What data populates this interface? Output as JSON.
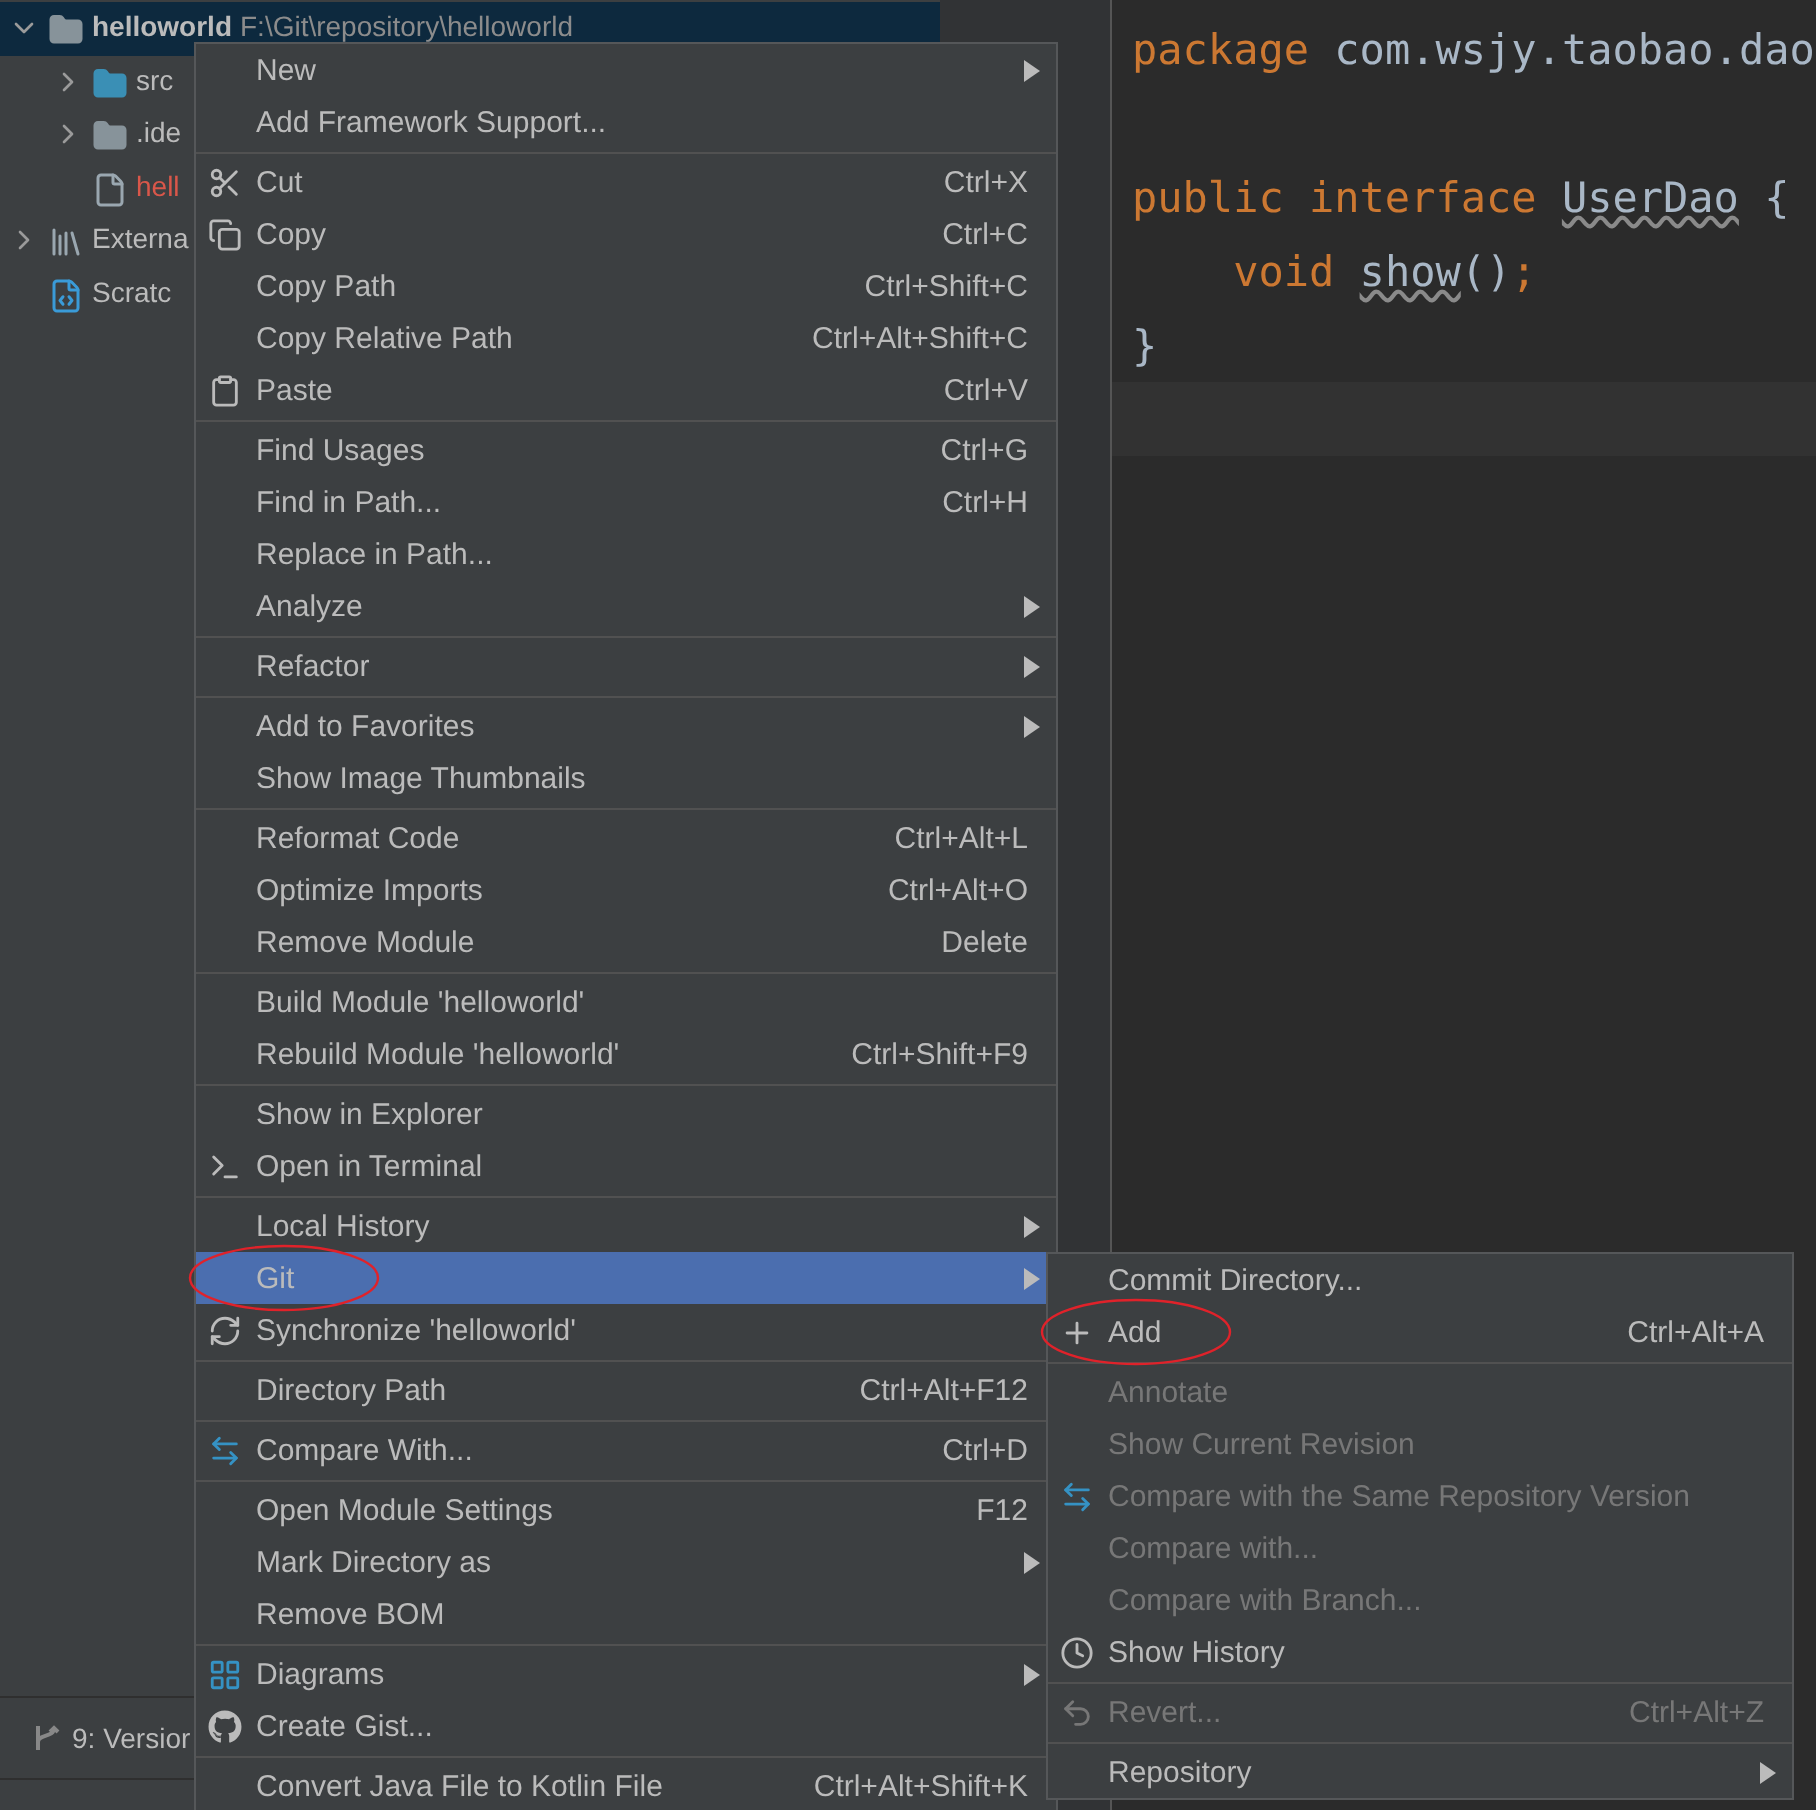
{
  "project": {
    "rows": [
      {
        "label": "helloworld",
        "detail": "F:\\Git\\repository\\helloworld",
        "kind": "module",
        "expanded": true,
        "selected": true,
        "children": [
          {
            "label": "src",
            "kind": "source-folder",
            "expanded": false,
            "selected": false
          },
          {
            "label": ".ide",
            "kind": "folder",
            "expanded": false,
            "selected": false
          },
          {
            "label": "hell",
            "kind": "file",
            "selected": false,
            "color": "#d9574a"
          }
        ]
      },
      {
        "label": "Externa",
        "kind": "library",
        "expanded": false,
        "selected": false
      },
      {
        "label": "Scratc",
        "kind": "scratch",
        "selected": false
      }
    ]
  },
  "editor": {
    "lines": [
      [
        {
          "tokens": [
            {
              "t": "package ",
              "kind": "keyword"
            },
            {
              "t": "com.wsjy.taobao.dao",
              "kind": "plain"
            }
          ]
        }
      ],
      [
        {
          "tokens": [
            {
              "t": "public interface ",
              "kind": "keyword"
            },
            {
              "t": "UserDao",
              "kind": "warn"
            },
            {
              "t": " {",
              "kind": "plain"
            }
          ]
        },
        {
          "tokens": [
            {
              "t": "    void ",
              "kind": "keyword"
            },
            {
              "t": "show",
              "kind": "warn"
            },
            {
              "t": "()",
              "kind": "plain"
            },
            {
              "t": ";",
              "kind": "keyword"
            }
          ]
        },
        {
          "tokens": [
            {
              "t": "}",
              "kind": "plain"
            }
          ]
        }
      ]
    ]
  },
  "tool_window": {
    "label": "9: Versior"
  },
  "menu": {
    "groups": [
      [
        {
          "label": "New",
          "submenu": true
        },
        {
          "label": "Add Framework Support..."
        }
      ],
      [
        {
          "label": "Cut",
          "shortcut": "Ctrl+X",
          "kind": "scissors"
        },
        {
          "label": "Copy",
          "shortcut": "Ctrl+C",
          "kind": "copy"
        },
        {
          "label": "Copy Path",
          "shortcut": "Ctrl+Shift+C"
        },
        {
          "label": "Copy Relative Path",
          "shortcut": "Ctrl+Alt+Shift+C"
        },
        {
          "label": "Paste",
          "shortcut": "Ctrl+V",
          "kind": "paste"
        }
      ],
      [
        {
          "label": "Find Usages",
          "shortcut": "Ctrl+G"
        },
        {
          "label": "Find in Path...",
          "shortcut": "Ctrl+H"
        },
        {
          "label": "Replace in Path..."
        },
        {
          "label": "Analyze",
          "submenu": true
        }
      ],
      [
        {
          "label": "Refactor",
          "submenu": true
        }
      ],
      [
        {
          "label": "Add to Favorites",
          "submenu": true
        },
        {
          "label": "Show Image Thumbnails"
        }
      ],
      [
        {
          "label": "Reformat Code",
          "shortcut": "Ctrl+Alt+L"
        },
        {
          "label": "Optimize Imports",
          "shortcut": "Ctrl+Alt+O"
        },
        {
          "label": "Remove Module",
          "shortcut": "Delete"
        }
      ],
      [
        {
          "label": "Build Module 'helloworld'"
        },
        {
          "label": "Rebuild Module 'helloworld'",
          "shortcut": "Ctrl+Shift+F9"
        }
      ],
      [
        {
          "label": "Show in Explorer"
        },
        {
          "label": "Open in Terminal",
          "kind": "terminal"
        }
      ],
      [
        {
          "label": "Local History",
          "submenu": true
        },
        {
          "label": "Git",
          "submenu": true,
          "selected": true,
          "annotated": true
        },
        {
          "label": "Synchronize 'helloworld'",
          "kind": "sync"
        }
      ],
      [
        {
          "label": "Directory Path",
          "shortcut": "Ctrl+Alt+F12"
        }
      ],
      [
        {
          "label": "Compare With...",
          "shortcut": "Ctrl+D",
          "kind": "compare"
        }
      ],
      [
        {
          "label": "Open Module Settings",
          "shortcut": "F12"
        },
        {
          "label": "Mark Directory as",
          "submenu": true
        },
        {
          "label": "Remove BOM"
        }
      ],
      [
        {
          "label": "Diagrams",
          "submenu": true,
          "kind": "diagram"
        },
        {
          "label": "Create Gist...",
          "kind": "github"
        }
      ],
      [
        {
          "label": "Convert Java File to Kotlin File",
          "shortcut": "Ctrl+Alt+Shift+K"
        }
      ]
    ]
  },
  "git_menu": {
    "groups": [
      [
        {
          "label": "Commit Directory..."
        },
        {
          "label": "Add",
          "shortcut": "Ctrl+Alt+A",
          "kind": "plus",
          "annotated": true
        }
      ],
      [
        {
          "label": "Annotate",
          "disabled": true
        },
        {
          "label": "Show Current Revision",
          "disabled": true
        },
        {
          "label": "Compare with the Same Repository Version",
          "disabled": true,
          "kind": "compare"
        },
        {
          "label": "Compare with...",
          "disabled": true
        },
        {
          "label": "Compare with Branch...",
          "disabled": true
        },
        {
          "label": "Show History",
          "kind": "history"
        }
      ],
      [
        {
          "label": "Revert...",
          "shortcut": "Ctrl+Alt+Z",
          "disabled": true,
          "kind": "revert"
        }
      ],
      [
        {
          "label": "Repository",
          "submenu": true
        }
      ]
    ]
  }
}
